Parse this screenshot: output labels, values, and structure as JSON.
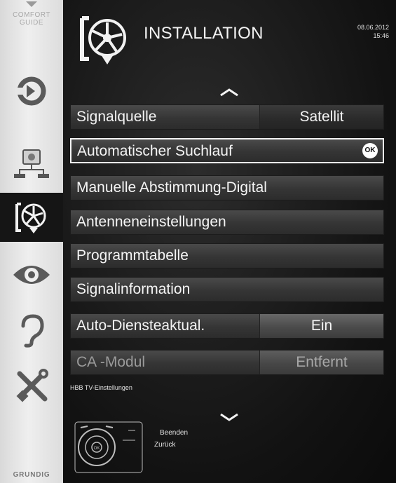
{
  "sidebar": {
    "top_label": "COMFORT GUIDE",
    "items": [
      {
        "name": "source-icon"
      },
      {
        "name": "network-icon"
      },
      {
        "name": "installation-icon",
        "active": true
      },
      {
        "name": "eye-icon"
      },
      {
        "name": "ear-icon"
      },
      {
        "name": "tools-icon"
      }
    ],
    "brand": "GRUNDIG"
  },
  "header": {
    "title": "INSTALLATION",
    "date": "08.06.2012",
    "time": "15:46"
  },
  "menu": [
    {
      "label": "Signalquelle",
      "value": "Satellit"
    },
    {
      "label": "Automatischer Suchlauf",
      "button": "OK",
      "selected": true
    },
    {
      "label": "Manuelle Abstimmung-Digital"
    },
    {
      "label": "Antenneneinstellungen"
    },
    {
      "label": "Programmtabelle"
    },
    {
      "label": "Signalinformation"
    },
    {
      "label": "Auto-Diensteaktual.",
      "value": "Ein"
    },
    {
      "label": "CA -Modul",
      "value": "Entfernt",
      "disabled": true
    }
  ],
  "footer": {
    "hint": "HBB TV-Einstellungen",
    "exit_label": "Beenden",
    "back_label": "Zurück",
    "remote_center": "OK"
  }
}
